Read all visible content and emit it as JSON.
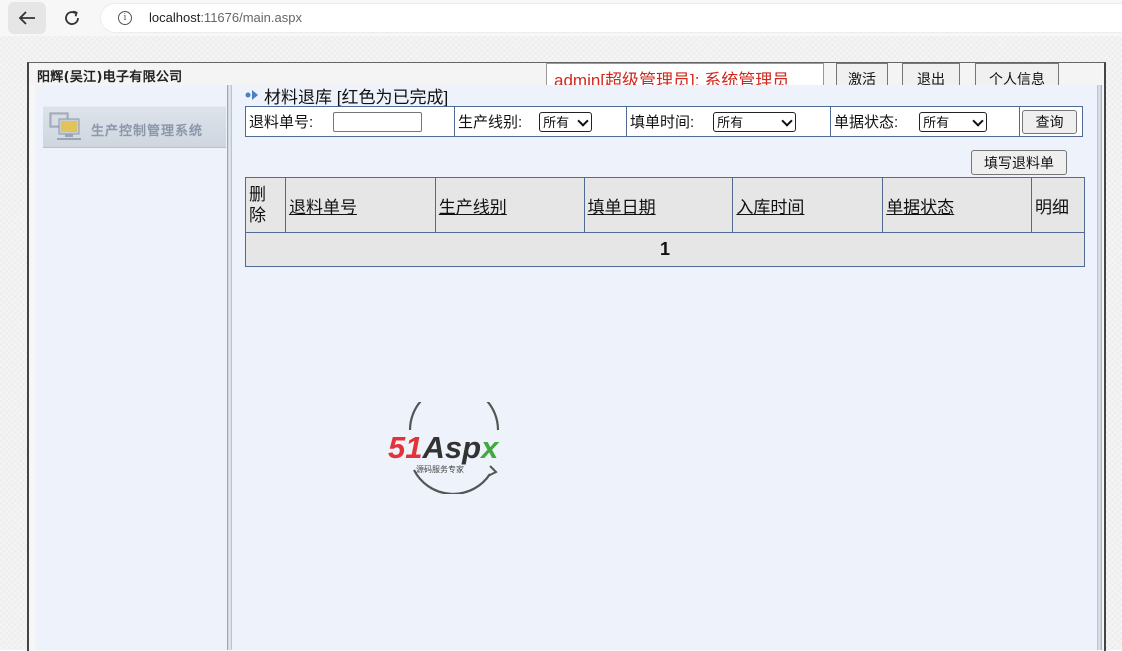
{
  "browser": {
    "url_host": "localhost",
    "url_rest": ":11676/main.aspx"
  },
  "header": {
    "company": "阳辉(吴江)电子有限公司",
    "user_info": "admin[超级管理员]:  系统管理员",
    "activate_label": "激活",
    "logout_label": "退出",
    "profile_label": "个人信息"
  },
  "sidebar": {
    "system_title": "生产控制管理系统"
  },
  "page": {
    "title": "材料退库 [红色为已完成]"
  },
  "filters": {
    "return_no_label": "退料单号:",
    "return_no_value": "",
    "line_label": "生产线别:",
    "line_value": "所有",
    "date_label": "填单时间:",
    "date_value": "所有",
    "status_label": "单据状态:",
    "status_value": "所有",
    "query_label": "查询"
  },
  "actions": {
    "fill_form_label": "填写退料单"
  },
  "table": {
    "columns": [
      "删除",
      "退料单号",
      "生产线别",
      "填单日期",
      "入库时间",
      "单据状态",
      "明细"
    ],
    "pager": "1"
  },
  "watermark": {
    "brand_red": "51",
    "brand_dark": "Asp",
    "brand_green": "x",
    "tagline": "源码服务专家"
  },
  "colors": {
    "user_info": "#d2281e",
    "table_border": "#4e6a95",
    "panel_bg": "#eef3fb"
  }
}
